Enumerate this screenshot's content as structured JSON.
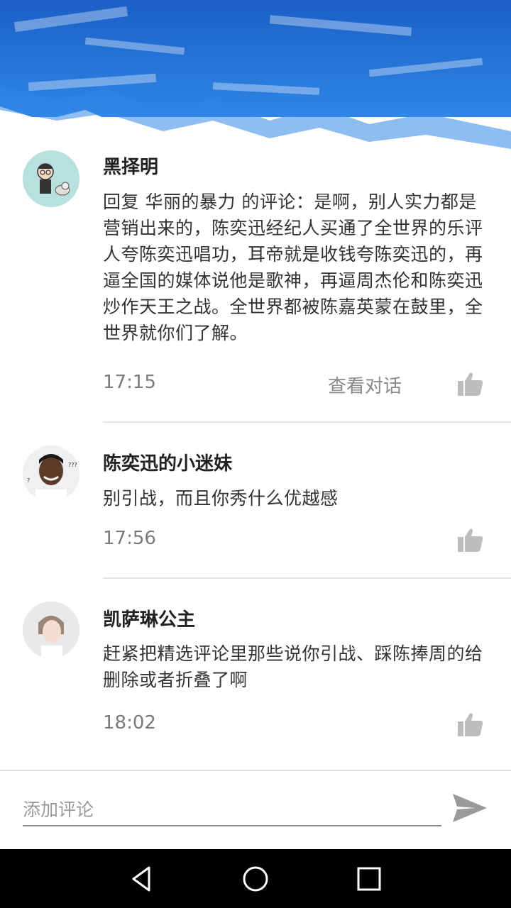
{
  "comments": [
    {
      "username": "黑择明",
      "text": "回复 华丽的暴力 的评论：是啊，别人实力都是营销出来的，陈奕迅经纪人买通了全世界的乐评人夸陈奕迅唱功，耳帝就是收钱夸陈奕迅的，再逼全国的媒体说他是歌神，再逼周杰伦和陈奕迅炒作天王之战。全世界都被陈嘉英蒙在鼓里，全世界就你们了解。",
      "time": "17:15",
      "view_conversation": "查看对话"
    },
    {
      "username": "陈奕迅的小迷妹",
      "text": "别引战，而且你秀什么优越感",
      "time": "17:56"
    },
    {
      "username": "凯萨琳公主",
      "text": "赶紧把精选评论里那些说你引战、踩陈捧周的给删除或者折叠了啊",
      "time": "18:02"
    }
  ],
  "input": {
    "placeholder": "添加评论"
  },
  "icons": {
    "like": "thumbs-up-icon",
    "send": "send-icon",
    "back": "back-triangle-icon",
    "home": "home-circle-icon",
    "recents": "recents-square-icon"
  },
  "colors": {
    "header_blue": "#1f6fd6",
    "icon_gray": "#bdbdbd",
    "nav_bg": "#000000"
  }
}
